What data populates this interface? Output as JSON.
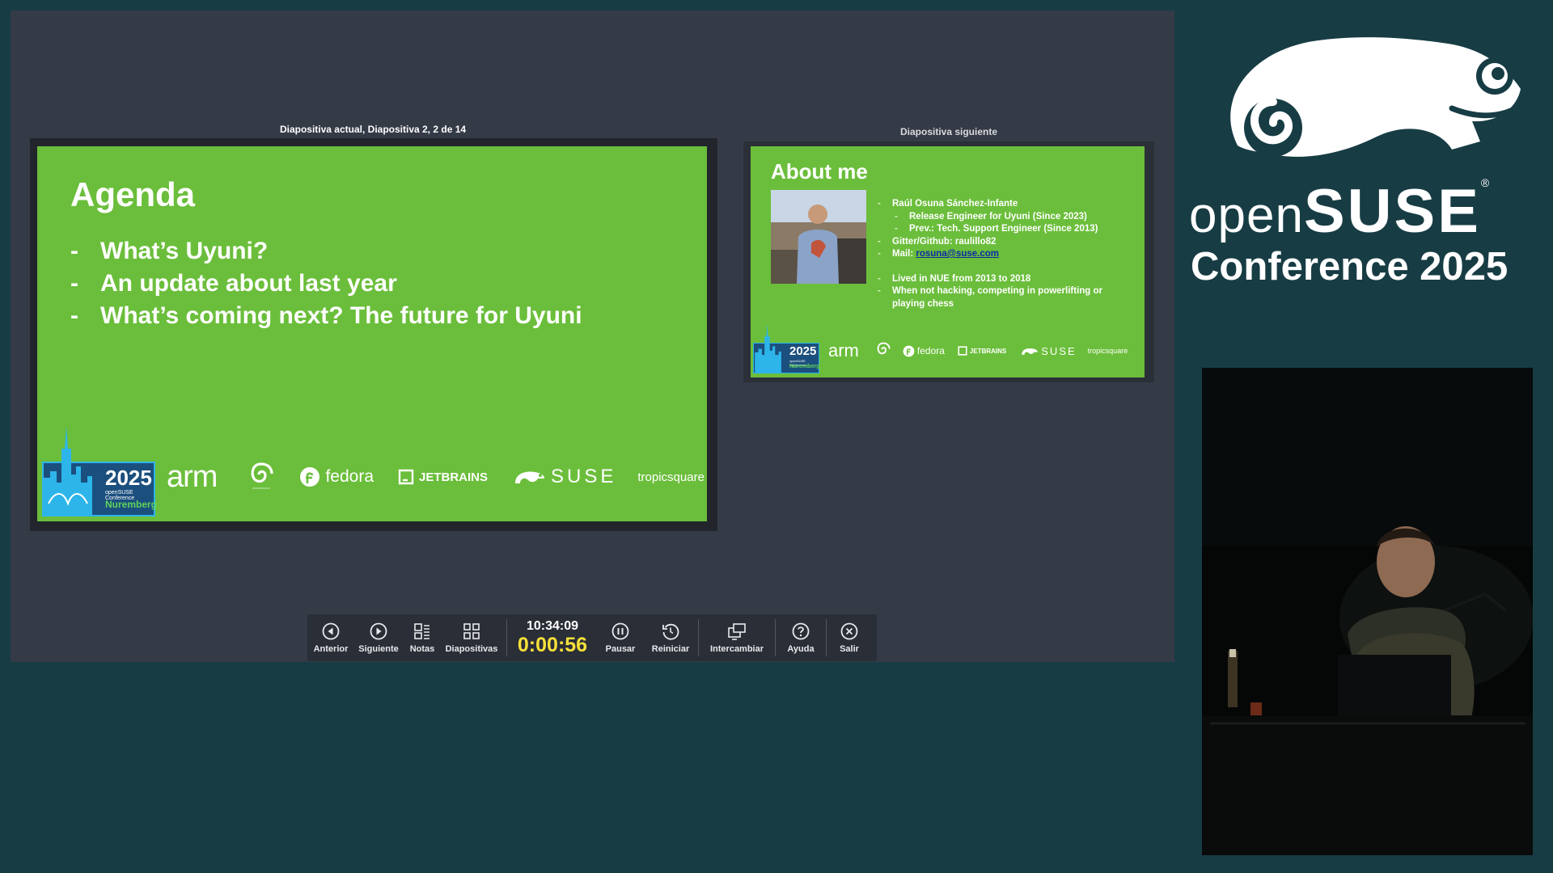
{
  "presenter": {
    "current_caption": "Diapositiva actual, Diapositiva 2, 2 de 14",
    "next_caption": "Diapositiva siguiente"
  },
  "current_slide": {
    "title": "Agenda",
    "items": [
      "What’s Uyuni?",
      "An update about last year",
      "What’s coming next? The future for Uyuni"
    ],
    "dash": "-"
  },
  "next_slide": {
    "title": "About me",
    "lines": [
      {
        "text": "Raúl Osuna Sánchez-Infante",
        "level": 1
      },
      {
        "text": "Release Engineer for Uyuni (Since 2023)",
        "level": 2
      },
      {
        "text": "Prev.: Tech. Support Engineer (Since 2013)",
        "level": 2
      },
      {
        "text": "Gitter/Github: raulillo82",
        "level": 1
      }
    ],
    "mail_label": "Mail: ",
    "mail": "rosuna@suse.com",
    "lines_after": [
      {
        "text": "Lived in NUE from 2013 to 2018",
        "level": 1
      },
      {
        "text": "When not hacking, competing in powerlifting or playing chess",
        "level": 1
      }
    ]
  },
  "sponsors": {
    "badge_year": "2025",
    "badge_sub": "openSUSE Conference",
    "badge_city": "Nuremberg",
    "arm": "arm",
    "fedora": "fedora",
    "jetbrains": "JETBRAINS",
    "suse": "SUSE",
    "tropicsquare": "tropicsquare"
  },
  "toolbar": {
    "prev": "Anterior",
    "next": "Siguiente",
    "notes": "Notas",
    "slides": "Diapositivas",
    "clock": "10:34:09",
    "elapsed": "0:00:56",
    "pause": "Pausar",
    "restart": "Reiniciar",
    "swap": "Intercambiar",
    "help": "Ayuda",
    "exit": "Salir"
  },
  "brand": {
    "open": "open",
    "suse": "SUSE",
    "reg": "®",
    "conference": "Conference 2025"
  },
  "colors": {
    "background": "#173c44",
    "presenter_bg": "#353a47",
    "slide_green": "#6bbe3b",
    "timer_yellow": "#f6e03a"
  }
}
